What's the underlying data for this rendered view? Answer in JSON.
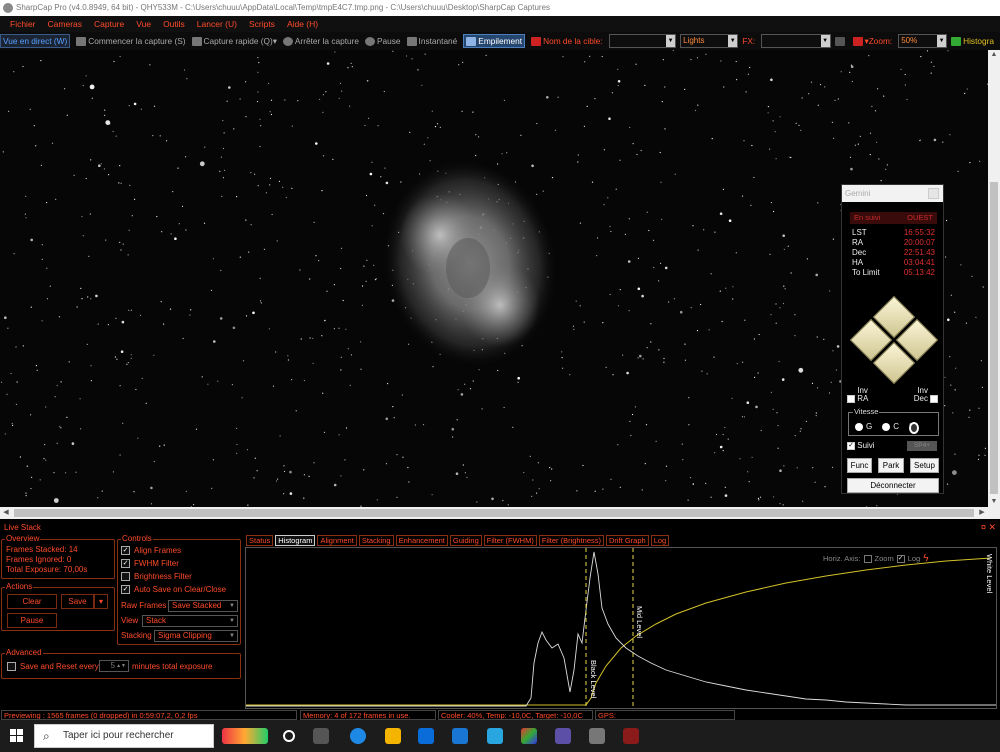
{
  "window": {
    "title": "SharpCap Pro (v4.0.8949, 64 bit) - QHY533M - C:\\Users\\chuuu\\AppData\\Local\\Temp\\tmpE4C7.tmp.png - C:\\Users\\chuuu\\Desktop\\SharpCap Captures"
  },
  "menu": [
    "Fichier",
    "Cameras",
    "Capture",
    "Vue",
    "Outils",
    "Lancer (U)",
    "Scripts",
    "Aide (H)"
  ],
  "toolbar": {
    "live": "Vue en direct (W)",
    "start_capture": "Commencer la capture (S)",
    "quick_capture": "Capture rapide (Q)",
    "stop_capture": "Arrêter la capture",
    "pause": "Pause",
    "snapshot": "Instantané",
    "stacking": "Empilement",
    "target_label": "Nom de la cible:",
    "target_value": "",
    "frame_type": "Lights",
    "fx_label": "FX:",
    "fx_value": "",
    "zoom_label": "Zoom:",
    "zoom_value": "50%",
    "histogram": "Histogra"
  },
  "gemini": {
    "title": "Gemini",
    "status": "En suivi",
    "side": "OUEST",
    "rows": [
      {
        "k": "LST",
        "v": "16:55:32"
      },
      {
        "k": "RA",
        "v": "20:00:07"
      },
      {
        "k": "Dec",
        "v": "22:51:43"
      },
      {
        "k": "HA",
        "v": "03:04:41"
      },
      {
        "k": "To Limit",
        "v": "05:13:42"
      }
    ],
    "inv_ra": "Inv RA",
    "inv_dec": "Inv Dec",
    "speed_label": "Vitesse",
    "speeds": [
      "G",
      "C",
      "S"
    ],
    "speed_selected": "S",
    "tracking": "Suivi",
    "speed_value": "SP4+",
    "btn_func": "Func",
    "btn_park": "Park",
    "btn_setup": "Setup",
    "btn_disconnect": "Déconnecter"
  },
  "livestack": {
    "title": "Live Stack",
    "controls": "¤ ✕",
    "overview": {
      "label": "Overview",
      "frames_stacked": "Frames Stacked: 14",
      "frames_ignored": "Frames Ignored:  0",
      "total_exposure": "Total Exposure:  70,00s"
    },
    "actions": {
      "label": "Actions",
      "clear": "Clear",
      "save": "Save",
      "pause": "Pause"
    },
    "controls_group": {
      "label": "Controls",
      "align": "Align Frames",
      "fwhm": "FWHM Filter",
      "brightness": "Brightness Filter",
      "autosave": "Auto Save on Clear/Close",
      "raw_label": "Raw Frames",
      "raw_value": "Save Stacked",
      "view_label": "View",
      "view_value": "Stack",
      "stacking_label": "Stacking",
      "stacking_value": "Sigma Clipping"
    },
    "advanced": {
      "label": "Advanced",
      "save_reset": "Save and Reset every",
      "minutes": "5",
      "minutes_suffix": "minutes total exposure"
    },
    "tabs": [
      "Status",
      "Histogram",
      "Alignment",
      "Stacking",
      "Enhancement",
      "Guiding",
      "Filter (FWHM)",
      "Filter (Brightness)",
      "Drift Graph",
      "Log"
    ],
    "active_tab": "Histogram",
    "histogram": {
      "horiz_axis": "Horiz. Axis:",
      "zoom": "Zoom",
      "log": "Log",
      "black_level": "Black Level",
      "mid_level": "Mid Level",
      "white_level": "White Level"
    }
  },
  "status": {
    "previewing": "Previewing : 1565 frames (0 dropped) in 0:59:07,2, 0,2 fps",
    "memory": "Memory: 4 of 172 frames in use.",
    "cooler": "Cooler: 40%, Temp: -10,0C, Target: -10,0C",
    "gps": "GPS:"
  },
  "taskbar": {
    "search_placeholder": "Taper ici pour rechercher"
  },
  "colors": {
    "accent": "#ff4b2b",
    "menu_bg": "#101010",
    "stack_blue": "#25476f",
    "curve": "#d4c12a"
  }
}
